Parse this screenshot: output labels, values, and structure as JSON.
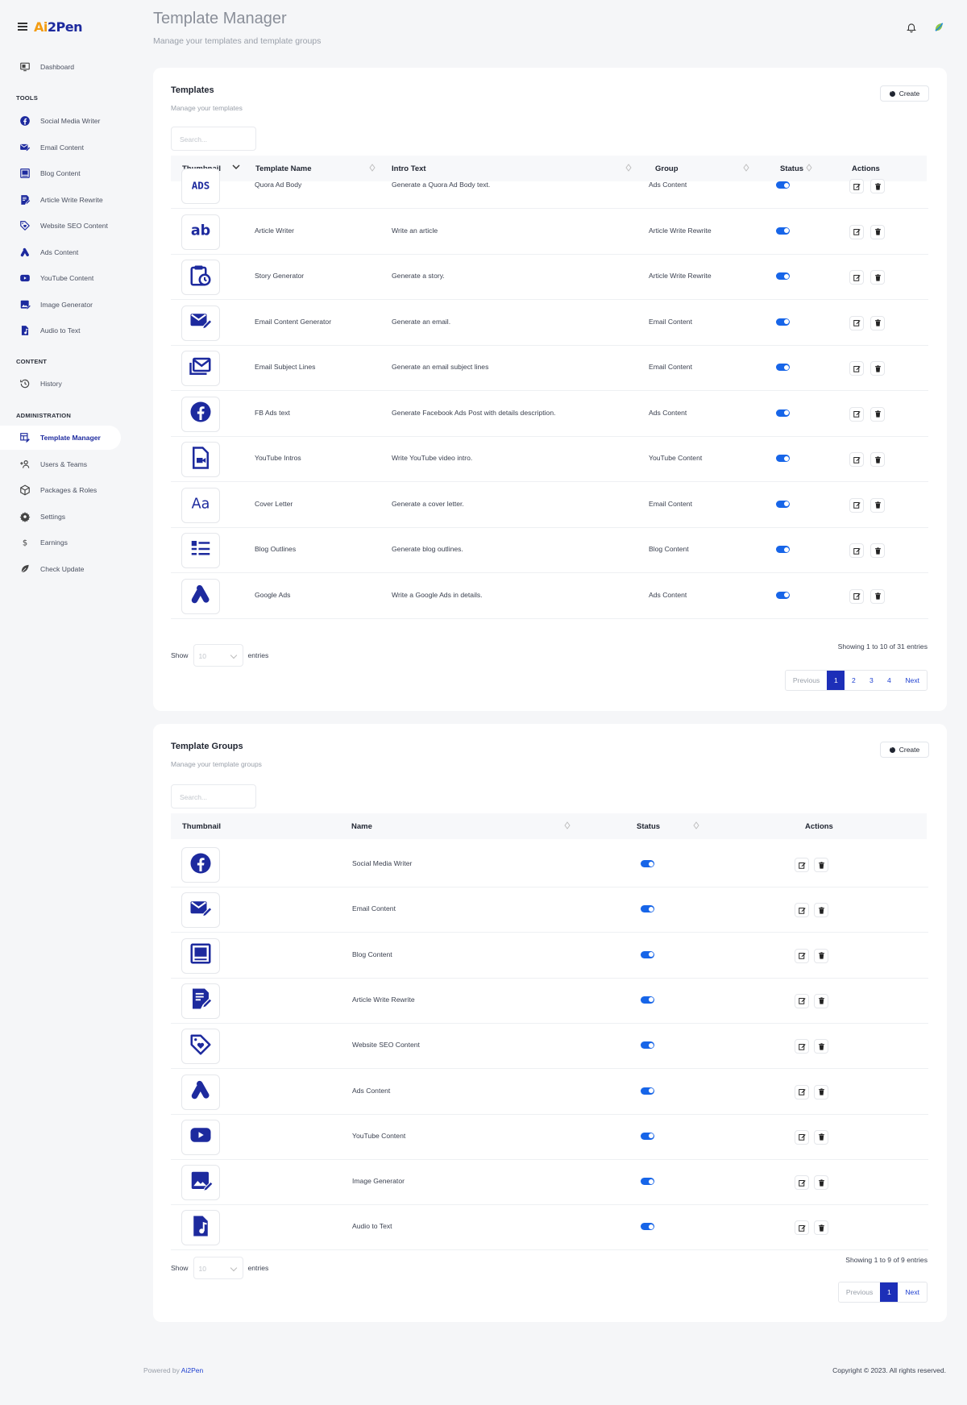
{
  "brand": {
    "logo_prefix": "Ai",
    "logo_suffix": "2Pen",
    "accent": "#1d2a9e",
    "logo_accent": "#f39c12"
  },
  "header": {
    "title": "Template Manager",
    "subtitle": "Manage your templates and template groups"
  },
  "sidebar": {
    "dashboard": "Dashboard",
    "tools_title": "TOOLS",
    "tools": [
      {
        "label": "Social Media Writer",
        "icon": "facebook-icon"
      },
      {
        "label": "Email Content",
        "icon": "email-edit-icon"
      },
      {
        "label": "Blog Content",
        "icon": "blog-icon"
      },
      {
        "label": "Article Write Rewrite",
        "icon": "article-icon"
      },
      {
        "label": "Website SEO Content",
        "icon": "tag-heart-icon"
      },
      {
        "label": "Ads Content",
        "icon": "google-ads-icon"
      },
      {
        "label": "YouTube Content",
        "icon": "youtube-icon"
      },
      {
        "label": "Image Generator",
        "icon": "image-edit-icon"
      },
      {
        "label": "Audio to Text",
        "icon": "audio-file-icon"
      }
    ],
    "content_title": "CONTENT",
    "history": "History",
    "admin_title": "ADMINISTRATION",
    "admin": [
      {
        "label": "Template Manager",
        "icon": "template-icon",
        "active": true
      },
      {
        "label": "Users & Teams",
        "icon": "users-icon"
      },
      {
        "label": "Packages & Roles",
        "icon": "package-icon"
      },
      {
        "label": "Settings",
        "icon": "gear-icon"
      },
      {
        "label": "Earnings",
        "icon": "dollar-icon"
      },
      {
        "label": "Check Update",
        "icon": "leaf-icon"
      }
    ]
  },
  "templates": {
    "title": "Templates",
    "subtitle": "Manage your templates",
    "create": "Create",
    "search_placeholder": "Search...",
    "columns": {
      "thumbnail": "Thumbnail",
      "name": "Template Name",
      "intro": "Intro Text",
      "group": "Group",
      "status": "Status",
      "actions": "Actions"
    },
    "rows": [
      {
        "icon": "ads-text-icon",
        "name": "Quora Ad Body",
        "intro": "Generate a Quora Ad Body text.",
        "group": "Ads Content",
        "status": true
      },
      {
        "icon": "ab-icon",
        "name": "Article Writer",
        "intro": "Write an article",
        "group": "Article Write Rewrite",
        "status": true
      },
      {
        "icon": "clipboard-clock-icon",
        "name": "Story Generator",
        "intro": "Generate a story.",
        "group": "Article Write Rewrite",
        "status": true
      },
      {
        "icon": "email-edit-icon",
        "name": "Email Content Generator",
        "intro": "Generate an email.",
        "group": "Email Content",
        "status": true
      },
      {
        "icon": "email-multiple-icon",
        "name": "Email Subject Lines",
        "intro": "Generate an email subject lines",
        "group": "Email Content",
        "status": true
      },
      {
        "icon": "facebook-icon",
        "name": "FB Ads text",
        "intro": "Generate Facebook Ads Post with details description.",
        "group": "Ads Content",
        "status": true
      },
      {
        "icon": "video-file-icon",
        "name": "YouTube Intros",
        "intro": "Write YouTube video intro.",
        "group": "YouTube Content",
        "status": true
      },
      {
        "icon": "font-aa-icon",
        "name": "Cover Letter",
        "intro": "Generate a cover letter.",
        "group": "Email Content",
        "status": true
      },
      {
        "icon": "list-outline-icon",
        "name": "Blog Outlines",
        "intro": "Generate blog outlines.",
        "group": "Blog Content",
        "status": true
      },
      {
        "icon": "google-ads-icon",
        "name": "Google Ads",
        "intro": "Write a Google Ads in details.",
        "group": "Ads Content",
        "status": true
      }
    ],
    "show_label": "Show",
    "entries_label": "entries",
    "page_size": "10",
    "info": "Showing 1 to 10 of 31 entries",
    "pagination": {
      "previous": "Previous",
      "pages": [
        "1",
        "2",
        "3",
        "4"
      ],
      "next": "Next",
      "current": "1"
    }
  },
  "groups": {
    "title": "Template Groups",
    "subtitle": "Manage your template groups",
    "create": "Create",
    "search_placeholder": "Search...",
    "columns": {
      "thumbnail": "Thumbnail",
      "name": "Name",
      "status": "Status",
      "actions": "Actions"
    },
    "rows": [
      {
        "icon": "facebook-icon",
        "name": "Social Media Writer",
        "status": true
      },
      {
        "icon": "email-edit-icon",
        "name": "Email Content",
        "status": true
      },
      {
        "icon": "blog-icon",
        "name": "Blog Content",
        "status": true
      },
      {
        "icon": "article-icon",
        "name": "Article Write Rewrite",
        "status": true
      },
      {
        "icon": "tag-heart-icon",
        "name": "Website SEO Content",
        "status": true
      },
      {
        "icon": "google-ads-icon",
        "name": "Ads Content",
        "status": true
      },
      {
        "icon": "youtube-icon",
        "name": "YouTube Content",
        "status": true
      },
      {
        "icon": "image-edit-icon",
        "name": "Image Generator",
        "status": true
      },
      {
        "icon": "audio-file-icon",
        "name": "Audio to Text",
        "status": true
      }
    ],
    "show_label": "Show",
    "entries_label": "entries",
    "page_size": "10",
    "info": "Showing 1 to 9 of 9 entries",
    "pagination": {
      "previous": "Previous",
      "pages": [
        "1"
      ],
      "next": "Next",
      "current": "1"
    }
  },
  "footer": {
    "powered_by": "Powered by",
    "brand_link": "Ai2Pen",
    "copyright": "Copyright © 2023. All rights reserved."
  }
}
